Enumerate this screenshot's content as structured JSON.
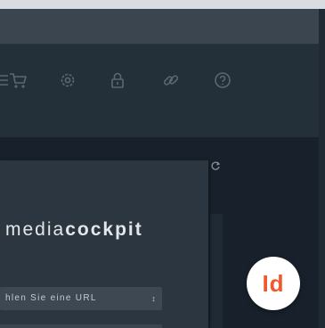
{
  "brand": {
    "light": "media",
    "bold": "cockpit"
  },
  "url_select": {
    "value": "hlen Sie eine URL",
    "arrows": "↕"
  },
  "badge": {
    "label": "Id",
    "color": "#f0582c"
  },
  "toolbar": {
    "icons": [
      "menu-icon",
      "cart-icon",
      "gear-icon",
      "lock-icon",
      "link-icon",
      "help-icon"
    ]
  },
  "colors": {
    "background": "#1b2530",
    "panel": "#2c3640",
    "toolbar": "#243039",
    "icon": "#5b6672"
  }
}
